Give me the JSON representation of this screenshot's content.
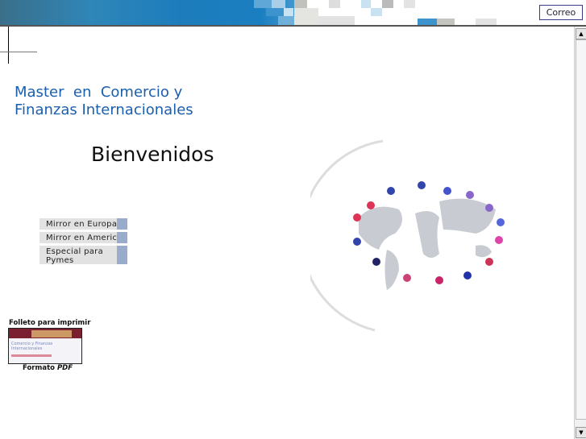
{
  "header": {
    "mail_button": "Correo"
  },
  "title": {
    "line1": "Master  en  Comercio y",
    "line2": "Finanzas Internacionales"
  },
  "welcome": "Bienvenidos",
  "menu": [
    {
      "label": "Mirror en Europa"
    },
    {
      "label": "Mirror en America"
    },
    {
      "label": "Especial para Pymes"
    }
  ],
  "brochure": {
    "label": "Folleto para imprimir",
    "format_prefix": "Formato ",
    "format": "PDF",
    "thumb_title": "Comercio y Finanzas Internacionales"
  },
  "colors": {
    "title": "#1a5fae",
    "menu_accent": "#9aaccc"
  }
}
